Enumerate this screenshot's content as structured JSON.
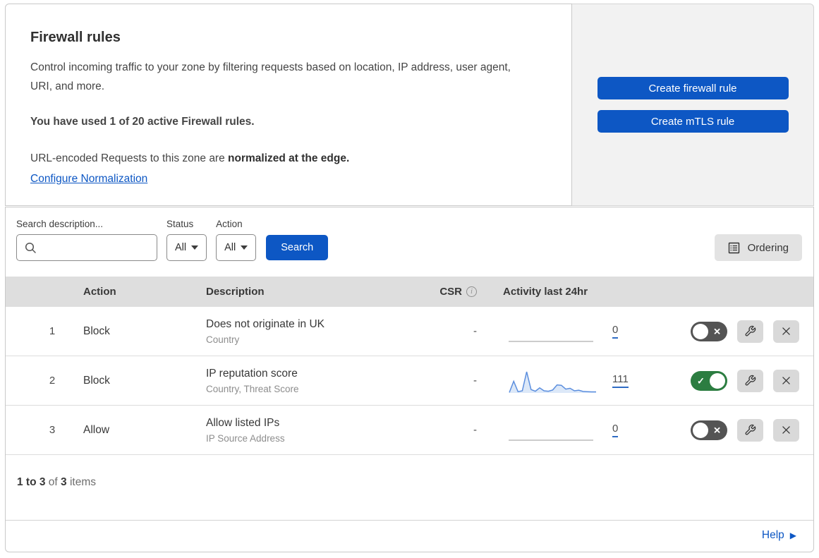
{
  "header": {
    "title": "Firewall rules",
    "description": "Control incoming traffic to your zone by filtering requests based on location, IP address, user agent, URI, and more.",
    "usage": "You have used 1 of 20 active Firewall rules.",
    "normalization_prefix": "URL-encoded Requests to this zone are",
    "normalization_bold": "normalized at the edge.",
    "normalization_link": "Configure Normalization"
  },
  "actions_panel": {
    "create_firewall_rule": "Create firewall rule",
    "create_mtls_rule": "Create mTLS rule"
  },
  "filters": {
    "search_label": "Search description...",
    "status_label": "Status",
    "status_value": "All",
    "action_label": "Action",
    "action_value": "All",
    "search_button": "Search",
    "ordering_button": "Ordering"
  },
  "table": {
    "headers": {
      "action": "Action",
      "description": "Description",
      "csr": "CSR",
      "activity": "Activity last 24hr"
    },
    "rows": [
      {
        "num": "1",
        "action": "Block",
        "description": "Does not originate in UK",
        "fields": "Country",
        "csr": "-",
        "activity_count": "0",
        "enabled": false
      },
      {
        "num": "2",
        "action": "Block",
        "description": "IP reputation score",
        "fields": "Country, Threat Score",
        "csr": "-",
        "activity_count": "111",
        "enabled": true,
        "sparkline": [
          2,
          55,
          6,
          10,
          100,
          16,
          8,
          24,
          10,
          8,
          14,
          38,
          36,
          18,
          22,
          10,
          13,
          7,
          6,
          5,
          5
        ]
      },
      {
        "num": "3",
        "action": "Allow",
        "description": "Allow listed IPs",
        "fields": "IP Source Address",
        "csr": "-",
        "activity_count": "0",
        "enabled": false
      }
    ]
  },
  "pagination": {
    "range": "1 to 3",
    "of": "of",
    "total": "3",
    "items": "items"
  },
  "help": {
    "label": "Help"
  },
  "colors": {
    "accent_blue": "#0d57c4",
    "toggle_on_green": "#2c7d41",
    "toggle_off_gray": "#545454",
    "sparkline_stroke": "#5b8ede",
    "sparkline_fill": "#dce8f8",
    "table_header_bg": "#dedede",
    "side_panel_bg": "#f2f2f2"
  }
}
